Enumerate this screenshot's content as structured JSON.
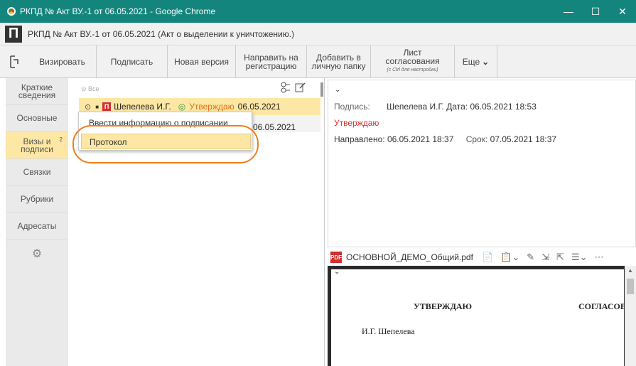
{
  "window": {
    "title": "РКПД № Акт ВУ.-1 от 06.05.2021 - Google Chrome",
    "minimize": "—",
    "maximize": "☐",
    "close": "✕"
  },
  "header": {
    "logo": "П",
    "doc_title": "РКПД №  Акт ВУ.-1 от 06.05.2021 (Акт о выделении к уничтожению.)"
  },
  "toolbar": {
    "visa": "Визировать",
    "sign": "Подписать",
    "new_version": "Новая версия",
    "send_reg_line1": "Направить на",
    "send_reg_line2": "регистрацию",
    "add_folder_line1": "Добавить в",
    "add_folder_line2": "личную папку",
    "sheet_line1": "Лист",
    "sheet_line2": "согласования",
    "sheet_hint": "(с Ctrl для настройки)",
    "more": "Еще",
    "more_chevron": "⌄"
  },
  "nav": {
    "items": [
      {
        "line1": "Краткие",
        "line2": "сведения"
      },
      {
        "line1": "Основные",
        "line2": ""
      },
      {
        "line1": "Визы и",
        "line2": "подписи",
        "badge": "2"
      },
      {
        "line1": "Связки",
        "line2": ""
      },
      {
        "line1": "Рубрики",
        "line2": ""
      },
      {
        "line1": "Адресаты",
        "line2": ""
      }
    ],
    "settings_icon": "⚙"
  },
  "visa_panel": {
    "all_toggle": "⊝ Все",
    "row": {
      "collapse": "⊙",
      "dot": "■",
      "badge": "П",
      "person": "Шепелева И.Г.",
      "status_icon": "◎",
      "status": "Утверждаю",
      "date": "06.05.2021"
    },
    "row2_date": "06.05.2021"
  },
  "context_menu": {
    "item1": "Ввести информацию о подписании",
    "item2": "Протокол"
  },
  "details": {
    "chevron": "⌄",
    "sign_label": "Подпись:",
    "sign_value": "Шепелева И.Г. Дата: 06.05.2021 18:53",
    "status": "Утверждаю",
    "sent_label": "Направлено:",
    "sent_value": "06.05.2021 18:37",
    "due_label": "Срок:",
    "due_value": "07.05.2021 18:37"
  },
  "viewer": {
    "file_name": "ОСНОВНОЙ_ДЕМО_Общий.pdf",
    "icons": [
      "📄",
      "📋⌄",
      "✎",
      "⇲",
      "⇱",
      "☰⌄",
      "⋯"
    ],
    "page": {
      "chevron": "⌄",
      "approve": "УТВЕРЖДАЮ",
      "agree": "СОГЛАСОВ",
      "name": "И.Г. Шепелева"
    }
  },
  "colors": {
    "titlebar": "#14857d",
    "highlight": "#fde7a4",
    "status_orange": "#e0720d",
    "annotation": "#f07d1a",
    "badge_red": "#d32f2f"
  }
}
